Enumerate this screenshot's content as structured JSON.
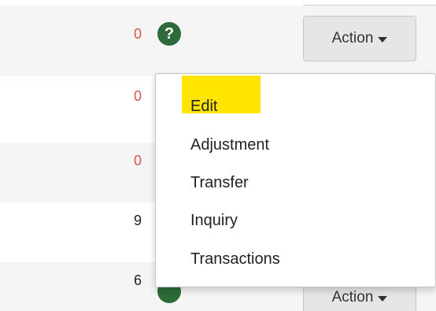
{
  "rows": [
    {
      "count": "0",
      "count_color": "#d9534f"
    },
    {
      "count": "0",
      "count_color": "#d9534f"
    },
    {
      "count": "0",
      "count_color": "#d9534f"
    },
    {
      "count": "9",
      "count_color": "#222222"
    },
    {
      "count": "6",
      "count_color": "#222222"
    }
  ],
  "help_icon": {
    "glyph": "?",
    "icon": "question-circle-icon",
    "color": "#2e6b3a"
  },
  "action_button": {
    "label": "Action",
    "icon": "caret-down-icon"
  },
  "dropdown_menu": {
    "items": [
      "Edit",
      "Adjustment",
      "Transfer",
      "Inquiry",
      "Transactions"
    ],
    "highlighted_item": "Edit",
    "highlight_color": "#ffe500"
  }
}
